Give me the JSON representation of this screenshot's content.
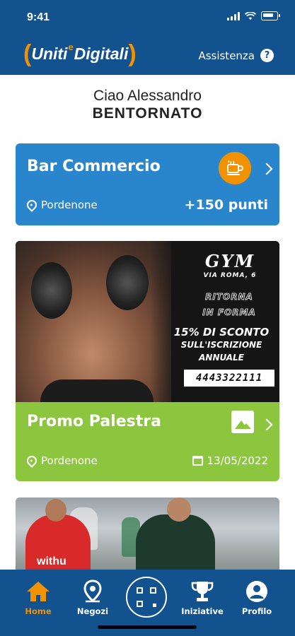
{
  "status": {
    "time": "9:41"
  },
  "header": {
    "logo_left": "Uniti",
    "logo_e": "e",
    "logo_right": "Digitali",
    "help_label": "Assistenza",
    "help_glyph": "?"
  },
  "greeting": {
    "line1": "Ciao Alessandro",
    "line2": "BENTORNATO"
  },
  "cards": {
    "bar": {
      "title": "Bar Commercio",
      "location": "Pordenone",
      "points": "+150 punti",
      "icon": "coffee-icon"
    },
    "promo": {
      "title": "Promo Palestra",
      "location": "Pordenone",
      "date": "13/05/2022",
      "ad": {
        "gym": "GYM",
        "address": "VIA ROMA, 6",
        "slogan_1": "RITORNA",
        "slogan_2": "IN FORMA",
        "offer_1": "15% DI SCONTO",
        "offer_2": "SULL'ISCRIZIONE",
        "offer_3": "ANNUALE",
        "phone": "4443322111"
      }
    },
    "sport": {
      "jersey": "withu"
    }
  },
  "tabs": [
    {
      "label": "Home",
      "icon": "home-icon",
      "active": true
    },
    {
      "label": "Negozi",
      "icon": "map-pin-icon",
      "active": false
    },
    {
      "label": "",
      "icon": "qr-code-icon",
      "active": false
    },
    {
      "label": "Iniziative",
      "icon": "trophy-icon",
      "active": false
    },
    {
      "label": "Profilo",
      "icon": "user-icon",
      "active": false
    }
  ],
  "colors": {
    "primary": "#12528f",
    "accent": "#f39200",
    "card_blue": "#2a86cc",
    "card_green": "#8cc63f"
  }
}
